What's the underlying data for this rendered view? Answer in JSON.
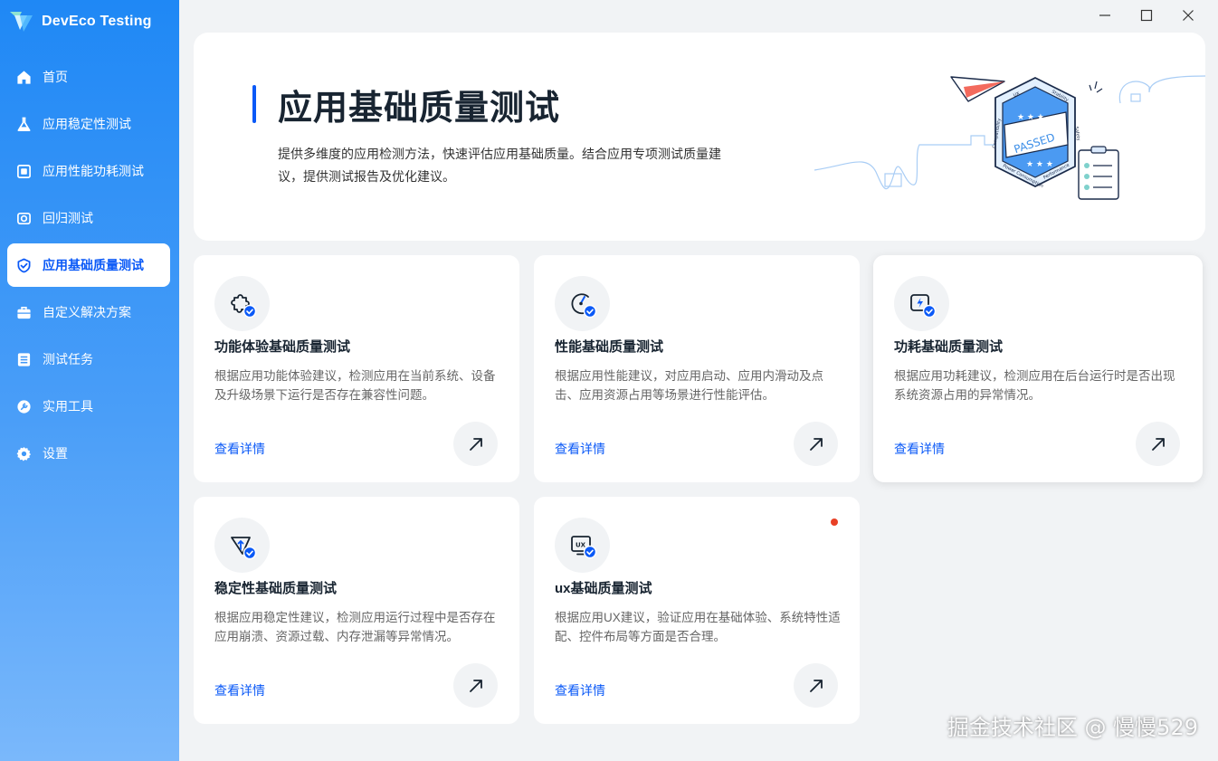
{
  "app": {
    "title": "DevEco Testing"
  },
  "sidebar": {
    "items": [
      {
        "label": "首页",
        "icon": "home-icon",
        "active": false
      },
      {
        "label": "应用稳定性测试",
        "icon": "flask-icon",
        "active": false
      },
      {
        "label": "应用性能功耗测试",
        "icon": "square-icon",
        "active": false
      },
      {
        "label": "回归测试",
        "icon": "camera-icon",
        "active": false
      },
      {
        "label": "应用基础质量测试",
        "icon": "shield-check-icon",
        "active": true
      },
      {
        "label": "自定义解决方案",
        "icon": "briefcase-icon",
        "active": false
      },
      {
        "label": "测试任务",
        "icon": "list-icon",
        "active": false
      },
      {
        "label": "实用工具",
        "icon": "wrench-icon",
        "active": false
      },
      {
        "label": "设置",
        "icon": "gear-icon",
        "active": false
      }
    ]
  },
  "hero": {
    "title": "应用基础质量测试",
    "description": "提供多维度的应用检测方法，快速评估应用基础质量。结合应用专项测试质量建议，提供测试报告及优化建议。",
    "badge_text": "PASSED",
    "badge_labels": [
      "UX",
      "Stability",
      "Safety",
      "Performance",
      "Power Consumption",
      "Compatibility"
    ]
  },
  "cards": [
    {
      "title": "功能体验基础质量测试",
      "desc": "根据应用功能体验建议，检测应用在当前系统、设备及升级场景下运行是否存在兼容性问题。",
      "link": "查看详情",
      "icon": "puzzle-check-icon"
    },
    {
      "title": "性能基础质量测试",
      "desc": "根据应用性能建议，对应用启动、应用内滑动及点击、应用资源占用等场景进行性能评估。",
      "link": "查看详情",
      "icon": "gauge-check-icon"
    },
    {
      "title": "功耗基础质量测试",
      "desc": "根据应用功耗建议，检测应用在后台运行时是否出现系统资源占用的异常情况。",
      "link": "查看详情",
      "icon": "power-check-icon"
    },
    {
      "title": "稳定性基础质量测试",
      "desc": "根据应用稳定性建议，检测应用运行过程中是否存在应用崩溃、资源过载、内存泄漏等异常情况。",
      "link": "查看详情",
      "icon": "funnel-check-icon"
    },
    {
      "title": "ux基础质量测试",
      "desc": "根据应用UX建议，验证应用在基础体验、系统特性适配、控件布局等方面是否合理。",
      "link": "查看详情",
      "icon": "ux-check-icon",
      "icon_text": "UX"
    }
  ],
  "watermark": "掘金技术社区 @ 慢慢529",
  "colors": {
    "accent": "#0a59f7",
    "sidebar_top": "#1f88f5",
    "sidebar_bottom": "#7ab8fb",
    "background": "#f1f3f5",
    "notification": "#e84026"
  }
}
